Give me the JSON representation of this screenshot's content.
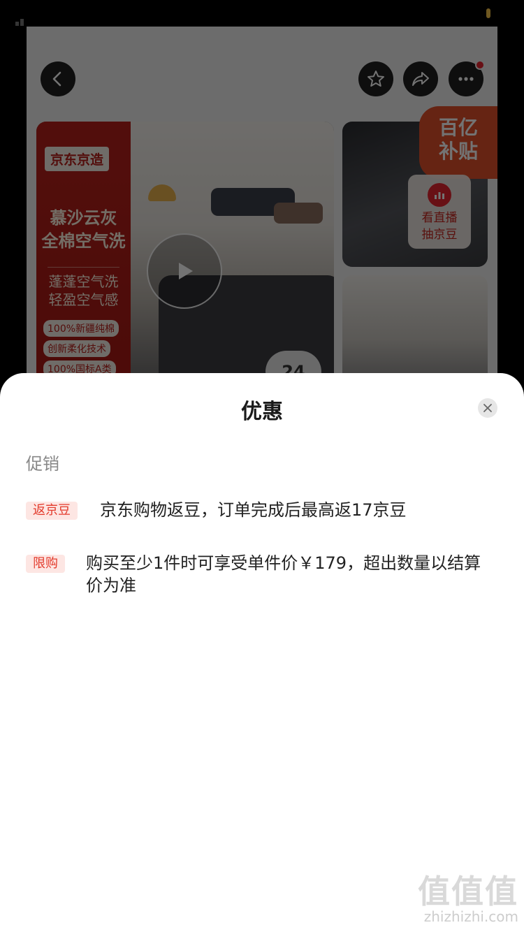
{
  "background_page": {
    "back_icon": "chevron-left-icon",
    "favorite_icon": "star-icon",
    "share_icon": "share-arrow-icon",
    "more_icon": "more-dots-icon",
    "hero": {
      "brand": "京东京造",
      "title_lines": [
        "慕沙云灰",
        "全棉空气洗"
      ],
      "sub_lines": [
        "蓬蓬空气洗",
        "轻盈空气感"
      ],
      "tags": [
        "100%新疆纯棉",
        "创新柔化技术",
        "100%国标A类"
      ],
      "play_icon": "play-icon",
      "image_count": "24"
    },
    "subsidy_badge": [
      "百亿",
      "补贴"
    ],
    "live": {
      "lines": [
        "看直播",
        "抽京豆"
      ],
      "icon": "live-bars-icon"
    }
  },
  "sheet": {
    "title": "优惠",
    "close_icon": "close-icon",
    "section": "促销",
    "promos": [
      {
        "badge": "返京豆",
        "text": "京东购物返豆，订单完成后最高返17京豆"
      },
      {
        "badge": "限购",
        "text": "购买至少1件时可享受单件价￥179，超出数量以结算价为准"
      }
    ]
  },
  "watermark": {
    "logo": "值值值",
    "url": "zhizhizhi.com"
  },
  "colors": {
    "accent": "#e33b2c",
    "badge_bg": "#fde6e3",
    "overlay": "rgba(0,0,0,0.55)"
  }
}
